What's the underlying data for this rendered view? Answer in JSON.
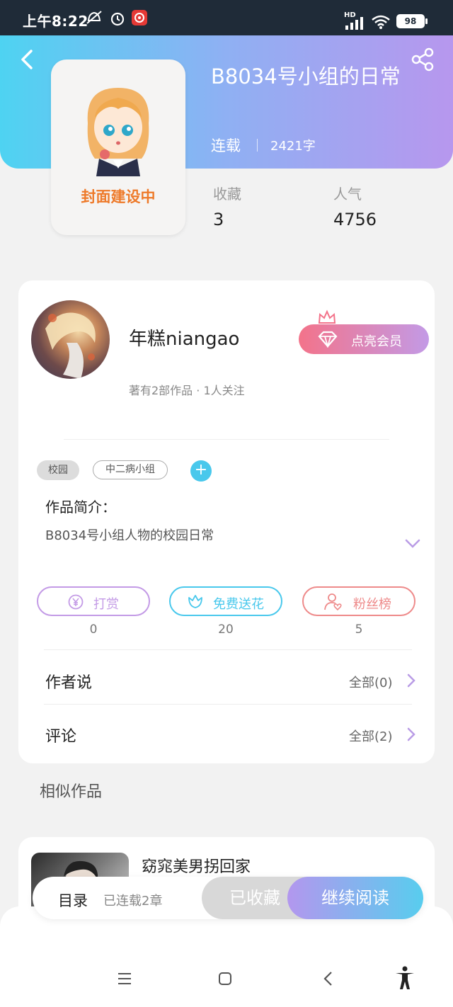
{
  "status_bar": {
    "time": "上午8:22",
    "network_badge": "HD",
    "battery": "98",
    "icons": [
      "mute-icon",
      "alarm-icon",
      "app-badge-icon",
      "signal-icon",
      "wifi-icon",
      "battery-icon"
    ]
  },
  "hero": {
    "title": "B8034号小组的日常",
    "status": "连载",
    "word_count": "2421字",
    "cover_text": "封面建设中",
    "stats": [
      {
        "label": "收藏",
        "value": "3"
      },
      {
        "label": "人气",
        "value": "4756"
      }
    ]
  },
  "author": {
    "name": "年糕niangao",
    "meta": "著有2部作品 · 1人关注",
    "vip_button": "点亮会员"
  },
  "tags": [
    "校园",
    "中二病小组"
  ],
  "intro": {
    "heading": "作品简介：",
    "text": "B8034号小组人物的校园日常"
  },
  "actions": [
    {
      "label": "打赏",
      "count": "0",
      "color": "#c39ae6"
    },
    {
      "label": "免费送花",
      "count": "20",
      "color": "#49c8ec"
    },
    {
      "label": "粉丝榜",
      "count": "5",
      "color": "#ee8a8a"
    }
  ],
  "rows": [
    {
      "title": "作者说",
      "link": "全部(0)"
    },
    {
      "title": "评论",
      "link": "全部(2)"
    }
  ],
  "similar": {
    "heading": "相似作品",
    "items": [
      {
        "title": "窈窕美男拐回家"
      }
    ]
  },
  "bottom_bar": {
    "toc": "目录",
    "toc_sub": "已连载2章",
    "favorited": "已收藏",
    "continue_reading": "继续阅读"
  },
  "colors": {
    "accent_purple": "#b797ee",
    "accent_cyan": "#4ed3f2",
    "vip_pink": "#f3738a"
  }
}
